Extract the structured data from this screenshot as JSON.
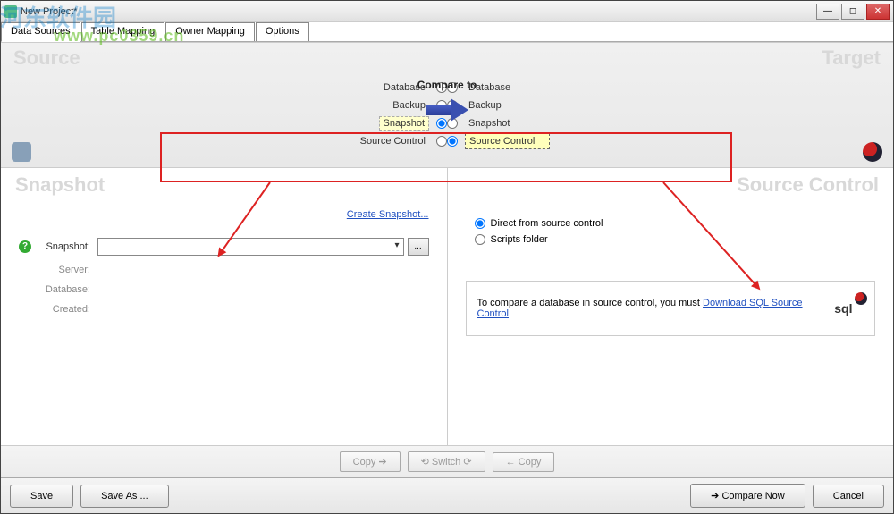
{
  "window": {
    "title": "New Project*"
  },
  "tabs": [
    "Data Sources",
    "Table Mapping",
    "Owner Mapping",
    "Options"
  ],
  "head": {
    "source_label": "Source",
    "target_label": "Target",
    "compare_to": "Compare to",
    "options": [
      "Database",
      "Backup",
      "Snapshot",
      "Source Control"
    ],
    "selected_source": "Snapshot",
    "selected_target": "Source Control"
  },
  "left_panel": {
    "title": "Snapshot",
    "create_link": "Create Snapshot...",
    "fields": {
      "snapshot": "Snapshot:",
      "server": "Server:",
      "database": "Database:",
      "created": "Created:"
    },
    "browse": "..."
  },
  "right_panel": {
    "title": "Source Control",
    "opt1": "Direct from source control",
    "opt2": "Scripts folder",
    "msg_prefix": "To compare a database in source control, you must ",
    "msg_link": "Download SQL Source Control",
    "logo_text": "sql"
  },
  "mid_buttons": {
    "copy_right": "Copy",
    "switch": "Switch",
    "copy_left": "Copy"
  },
  "footer": {
    "save": "Save",
    "save_as": "Save As ...",
    "compare_now": "Compare Now",
    "cancel": "Cancel"
  },
  "watermark": {
    "line1": "河东软件园",
    "line2": "www.pc0359.cn"
  }
}
